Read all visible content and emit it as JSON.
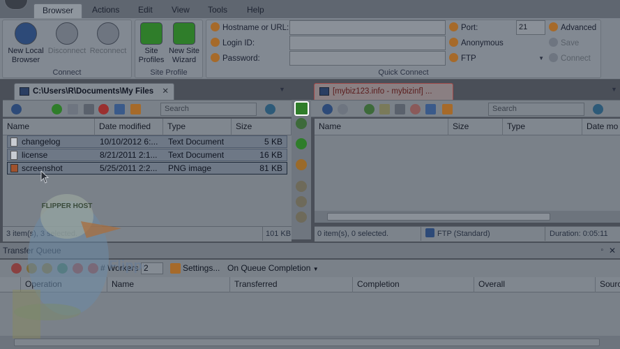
{
  "ribbon": {
    "tabs": [
      {
        "label": "Browser",
        "active": true
      },
      {
        "label": "Actions"
      },
      {
        "label": "Edit"
      },
      {
        "label": "View"
      },
      {
        "label": "Tools"
      },
      {
        "label": "Help"
      }
    ],
    "connect_group": {
      "label": "Connect",
      "new_local_browser": "New Local Browser",
      "disconnect": "Disconnect",
      "reconnect": "Reconnect"
    },
    "site_profile_group": {
      "label": "Site Profile",
      "site_profiles": "Site Profiles",
      "new_site_wizard": "New Site Wizard"
    },
    "quick_connect": {
      "label": "Quick Connect",
      "hostname_label": "Hostname or URL:",
      "hostname_value": "",
      "login_label": "Login ID:",
      "login_value": "",
      "password_label": "Password:",
      "password_value": "",
      "port_label": "Port:",
      "port_value": "21",
      "anonymous_label": "Anonymous",
      "protocol_label": "FTP",
      "advanced_label": "Advanced",
      "save_label": "Save",
      "connect_label": "Connect"
    }
  },
  "local_pane": {
    "tab_title": "C:\\Users\\R\\Documents\\My Files",
    "search_placeholder": "Search",
    "columns": [
      "Name",
      "Date modified",
      "Type",
      "Size"
    ],
    "rows": [
      {
        "name": "changelog",
        "date": "10/10/2012 6:...",
        "type": "Text Document",
        "size": "5 KB"
      },
      {
        "name": "license",
        "date": "8/21/2011 2:1...",
        "type": "Text Document",
        "size": "16 KB"
      },
      {
        "name": "screenshot",
        "date": "5/25/2011 2:2...",
        "type": "PNG image",
        "size": "81 KB"
      }
    ],
    "status_left": "3 item(s), 3 selected.",
    "status_right": "101 KB"
  },
  "remote_pane": {
    "tab_title": "[mybiz123.info - mybizinf] ...",
    "search_placeholder": "Search",
    "columns": [
      "Name",
      "Size",
      "Type",
      "Date mo"
    ],
    "status_left": "0 item(s), 0 selected.",
    "status_mid": "FTP (Standard)",
    "status_right": "Duration: 0:05:11"
  },
  "queue": {
    "title": "Transfer Queue",
    "workers_label": "# Workers",
    "workers_value": "2",
    "settings_label": "Settings...",
    "completion_label": "On Queue Completion",
    "columns": [
      "Operation",
      "Name",
      "Transferred",
      "Completion",
      "Overall",
      "Sourc"
    ]
  },
  "watermark": {
    "badge": "FLIPPER HOST",
    "brand": "FlipperHost"
  },
  "colors": {
    "accent_green": "#2f7d2a",
    "remote_tab_accent": "#a04848",
    "highlight_frame": "#ffffff"
  }
}
